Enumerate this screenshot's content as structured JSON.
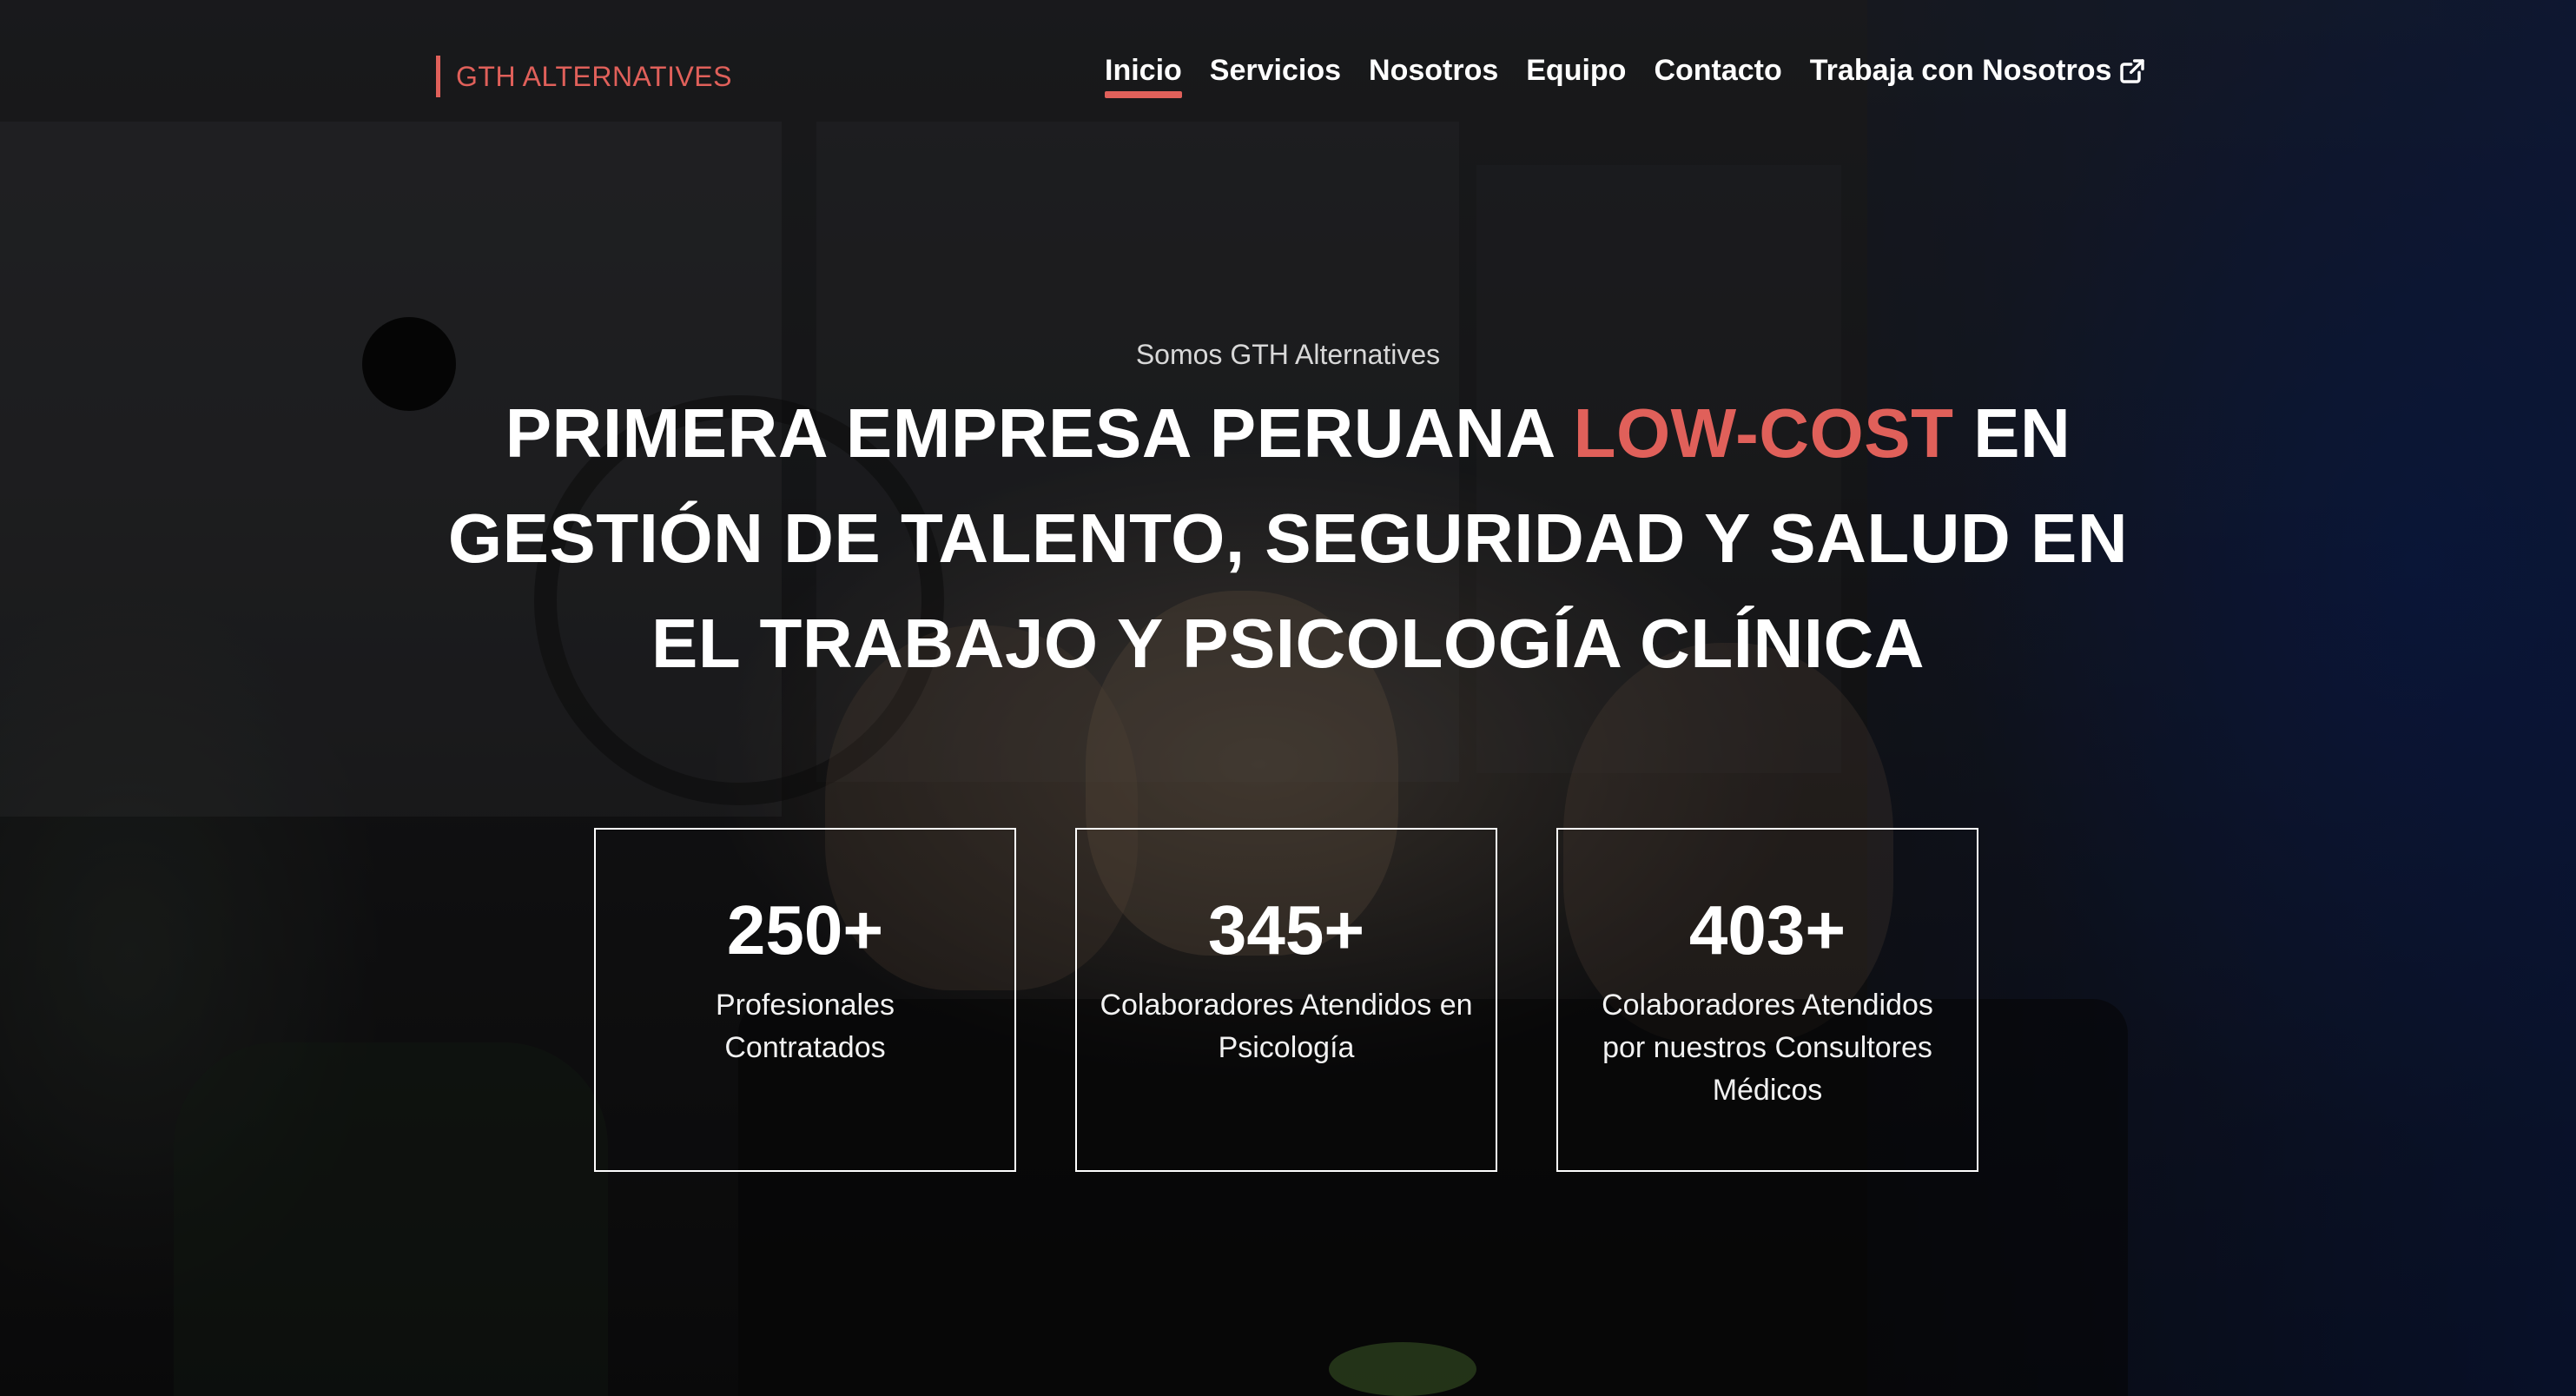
{
  "brand": {
    "logo_text": "GTH ALTERNATIVES",
    "accent_color": "#e0605a"
  },
  "nav": {
    "items": [
      {
        "label": "Inicio",
        "active": true
      },
      {
        "label": "Servicios",
        "active": false
      },
      {
        "label": "Nosotros",
        "active": false
      },
      {
        "label": "Equipo",
        "active": false
      },
      {
        "label": "Contacto",
        "active": false
      },
      {
        "label": "Trabaja con Nosotros",
        "active": false,
        "icon": "external-link-icon"
      }
    ]
  },
  "hero": {
    "subtitle": "Somos GTH Alternatives",
    "headline_part1": "PRIMERA EMPRESA PERUANA ",
    "headline_accent": "LOW-COST",
    "headline_part2": " EN GESTIÓN DE TALENTO, SEGURIDAD Y SALUD EN EL TRABAJO Y PSICOLOGÍA CLÍNICA"
  },
  "stats": [
    {
      "value": "250+",
      "label": "Profesionales Contratados"
    },
    {
      "value": "345+",
      "label": "Colaboradores Atendidos en Psicología"
    },
    {
      "value": "403+",
      "label": "Colaboradores Atendidos por nuestros Consultores Médicos"
    }
  ]
}
